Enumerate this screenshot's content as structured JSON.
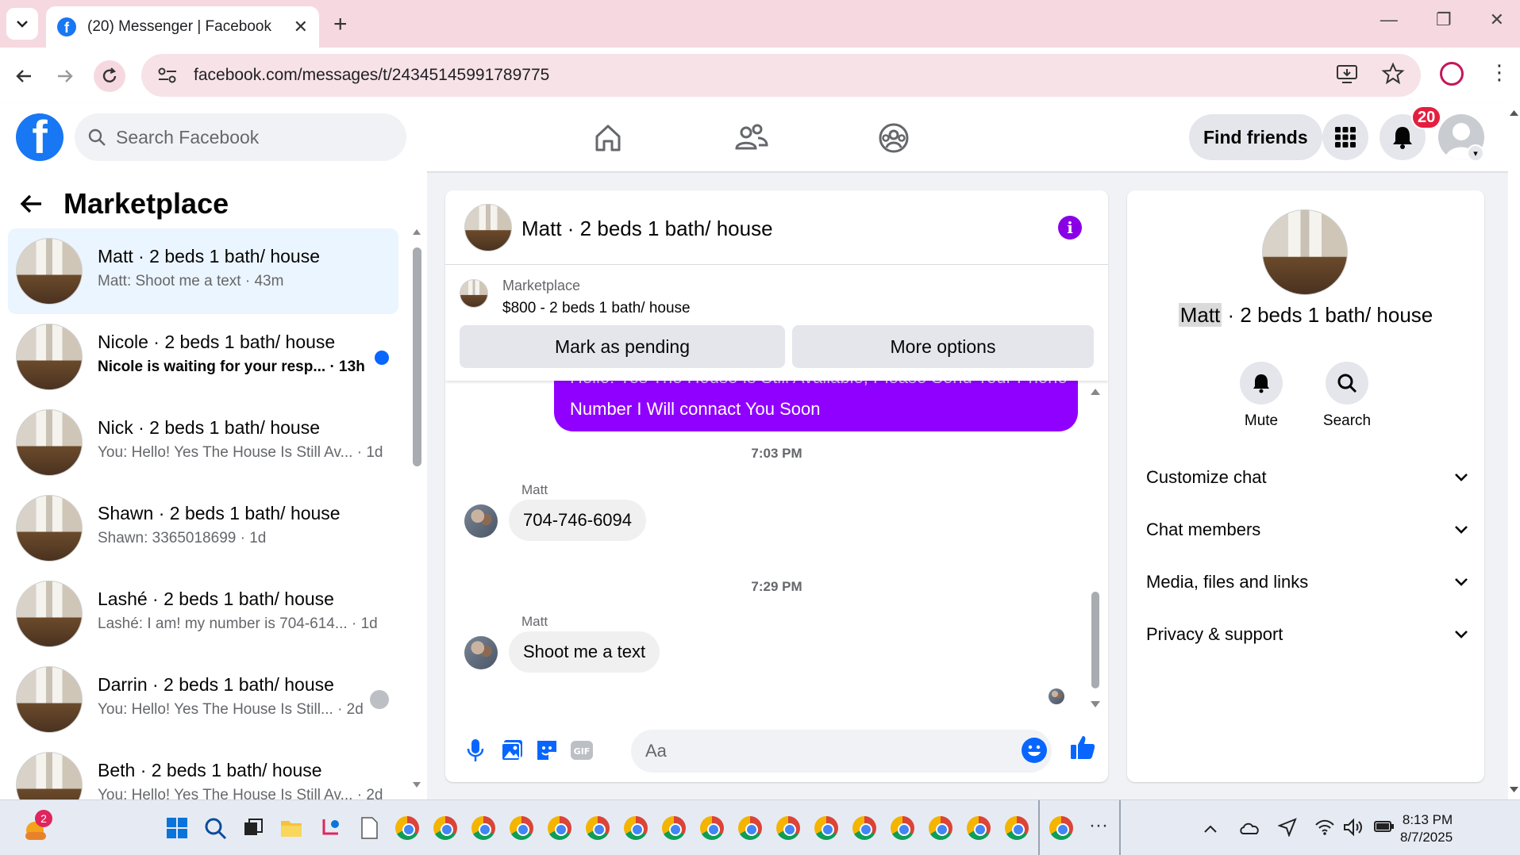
{
  "browser": {
    "tab_title": "(20) Messenger | Facebook",
    "url": "facebook.com/messages/t/24345145991789775",
    "new_tab_symbol": "+",
    "close_tab_symbol": "✕"
  },
  "fb_header": {
    "search_placeholder": "Search Facebook",
    "find_friends_label": "Find friends",
    "notification_count": "20"
  },
  "left_panel": {
    "title": "Marketplace",
    "conversations": [
      {
        "name": "Matt · 2 beds 1 bath/ house",
        "preview": "Matt: Shoot me a text · 43m",
        "active": true
      },
      {
        "name": "Nicole · 2 beds 1 bath/ house",
        "preview": "Nicole is waiting for your resp... · 13h",
        "unread": true
      },
      {
        "name": "Nick · 2 beds 1 bath/ house",
        "preview": "You: Hello! Yes The House Is Still Av... · 1d"
      },
      {
        "name": "Shawn · 2 beds 1 bath/ house",
        "preview": "Shawn: 3365018699 · 1d"
      },
      {
        "name": "Lashé · 2 beds 1 bath/ house",
        "preview": "Lashé: I am! my number is 704-614... · 1d"
      },
      {
        "name": "Darrin · 2 beds 1 bath/ house",
        "preview": "You: Hello! Yes The House Is Still... · 2d"
      },
      {
        "name": "Beth · 2 beds 1 bath/ house",
        "preview": "You: Hello! Yes The House Is Still Av... · 2d"
      }
    ]
  },
  "chat": {
    "header_name": "Matt · 2 beds 1 bath/ house",
    "marketplace_label": "Marketplace",
    "listing": "$800 - 2 beds 1 bath/ house",
    "mark_pending_label": "Mark as pending",
    "more_options_label": "More options",
    "outgoing_clipped": "Hello! Yes The House Is Still Available, Please Send Your Phone",
    "outgoing_line2": "Number I Will connact You Soon",
    "time_1": "7:03 PM",
    "sender_1": "Matt",
    "message_1": "704-746-6094",
    "time_2": "7:29 PM",
    "sender_2": "Matt",
    "message_2": "Shoot me a text",
    "composer_placeholder": "Aa"
  },
  "right_panel": {
    "name_highlight": "Matt",
    "name_rest": " · 2 beds 1 bath/ house",
    "mute_label": "Mute",
    "search_label": "Search",
    "sections": [
      "Customize chat",
      "Chat members",
      "Media, files and links",
      "Privacy & support"
    ]
  },
  "taskbar": {
    "badge": "2",
    "time": "8:13 PM",
    "date": "8/7/2025",
    "overflow": "···"
  },
  "colors": {
    "fb_blue": "#1877f2",
    "messenger_purple": "#9000ff",
    "active_row": "#ebf5ff",
    "badge_red": "#e41e3f"
  }
}
